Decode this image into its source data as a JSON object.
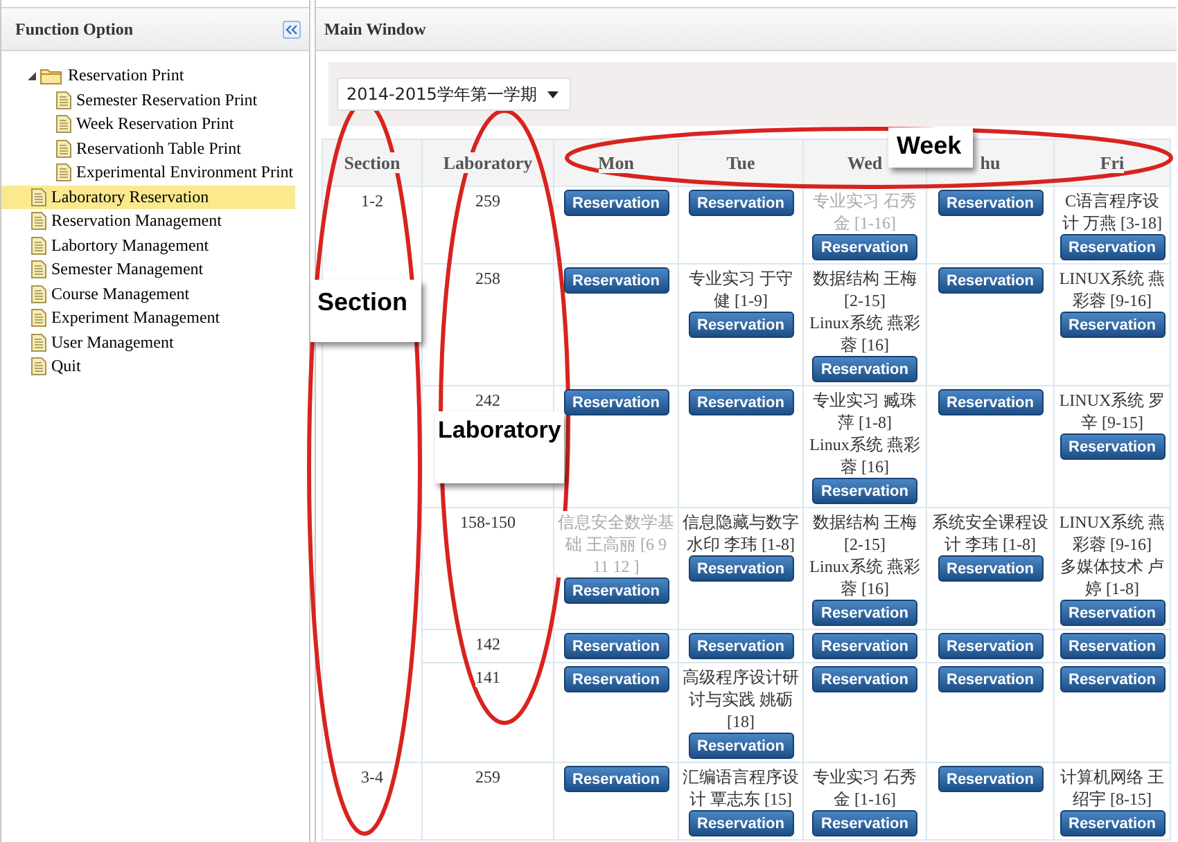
{
  "sidebar": {
    "title": "Function Option",
    "tree": [
      {
        "label": "Reservation Print",
        "kind": "folder",
        "expanded": true,
        "selected": false,
        "children": [
          {
            "label": "Semester Reservation Print",
            "kind": "page",
            "selected": false
          },
          {
            "label": "Week Reservation Print",
            "kind": "page",
            "selected": false
          },
          {
            "label": "Reservationh Table Print",
            "kind": "page",
            "selected": false
          },
          {
            "label": "Experimental Environment Print",
            "kind": "page",
            "selected": false
          }
        ]
      },
      {
        "label": "Laboratory Reservation",
        "kind": "page",
        "selected": true
      },
      {
        "label": "Reservation Management",
        "kind": "page",
        "selected": false
      },
      {
        "label": "Labortory Management",
        "kind": "page",
        "selected": false
      },
      {
        "label": "Semester Management",
        "kind": "page",
        "selected": false
      },
      {
        "label": "Course Management",
        "kind": "page",
        "selected": false
      },
      {
        "label": "Experiment Management",
        "kind": "page",
        "selected": false
      },
      {
        "label": "User Management",
        "kind": "page",
        "selected": false
      },
      {
        "label": "Quit",
        "kind": "page",
        "selected": false
      }
    ]
  },
  "main": {
    "title": "Main Window",
    "semester": "2014-2015学年第一学期",
    "table": {
      "columns": [
        "Section",
        "Laboratory",
        "Mon",
        "Tue",
        "Wed",
        "hu",
        "Fri"
      ],
      "sections": [
        {
          "label": "1-2",
          "rows": [
            {
              "lab": "259",
              "cells": [
                {
                  "button": "Reservation"
                },
                {
                  "button": "Reservation"
                },
                {
                  "courses": [
                    {
                      "text": "专业实习 石秀金 [1-16]",
                      "faded": true
                    }
                  ],
                  "button": "Reservation"
                },
                {
                  "button": "Reservation"
                },
                {
                  "courses": [
                    {
                      "text": "C语言程序设计 万燕 [3-18]",
                      "faded": false
                    }
                  ],
                  "button": "Reservation"
                }
              ]
            },
            {
              "lab": "258",
              "cells": [
                {
                  "button": "Reservation"
                },
                {
                  "courses": [
                    {
                      "text": "专业实习 于守健 [1-9]",
                      "faded": false
                    }
                  ],
                  "button": "Reservation"
                },
                {
                  "courses": [
                    {
                      "text": "数据结构 王梅 [2-15]",
                      "faded": false
                    },
                    {
                      "text": "Linux系统 燕彩蓉 [16]",
                      "faded": false
                    }
                  ],
                  "button": "Reservation"
                },
                {
                  "button": "Reservation"
                },
                {
                  "courses": [
                    {
                      "text": "LINUX系统 燕彩蓉 [9-16]",
                      "faded": false
                    }
                  ],
                  "button": "Reservation"
                }
              ]
            },
            {
              "lab": "242",
              "cells": [
                {
                  "button": "Reservation"
                },
                {
                  "button": "Reservation"
                },
                {
                  "courses": [
                    {
                      "text": "专业实习 臧珠萍 [1-8]",
                      "faded": false
                    },
                    {
                      "text": "Linux系统 燕彩蓉 [16]",
                      "faded": false
                    }
                  ],
                  "button": "Reservation"
                },
                {
                  "button": "Reservation"
                },
                {
                  "courses": [
                    {
                      "text": "LINUX系统 罗辛 [9-15]",
                      "faded": false
                    }
                  ],
                  "button": "Reservation"
                }
              ]
            },
            {
              "lab": "158-150",
              "cells": [
                {
                  "courses": [
                    {
                      "text": "信息安全数学基础 王高丽 [6 9 11 12 ]",
                      "faded": true
                    }
                  ],
                  "button": "Reservation"
                },
                {
                  "courses": [
                    {
                      "text": "信息隐藏与数字水印 李玮 [1-8]",
                      "faded": false
                    }
                  ],
                  "button": "Reservation"
                },
                {
                  "courses": [
                    {
                      "text": "数据结构 王梅 [2-15]",
                      "faded": false
                    },
                    {
                      "text": "Linux系统 燕彩蓉 [16]",
                      "faded": false
                    }
                  ],
                  "button": "Reservation"
                },
                {
                  "courses": [
                    {
                      "text": "系统安全课程设计 李玮 [1-8]",
                      "faded": false
                    }
                  ],
                  "button": "Reservation"
                },
                {
                  "courses": [
                    {
                      "text": "LINUX系统 燕彩蓉 [9-16]",
                      "faded": false
                    },
                    {
                      "text": "多媒体技术 卢婷 [1-8]",
                      "faded": false
                    }
                  ],
                  "button": "Reservation"
                }
              ]
            },
            {
              "lab": "142",
              "cells": [
                {
                  "button": "Reservation"
                },
                {
                  "button": "Reservation"
                },
                {
                  "button": "Reservation"
                },
                {
                  "button": "Reservation"
                },
                {
                  "button": "Reservation"
                }
              ]
            },
            {
              "lab": "141",
              "cells": [
                {
                  "button": "Reservation"
                },
                {
                  "courses": [
                    {
                      "text": "高级程序设计研讨与实践 姚砺 [18]",
                      "faded": false
                    }
                  ],
                  "button": "Reservation"
                },
                {
                  "button": "Reservation"
                },
                {
                  "button": "Reservation"
                },
                {
                  "button": "Reservation"
                }
              ]
            }
          ]
        },
        {
          "label": "3-4",
          "rows": [
            {
              "lab": "259",
              "cells": [
                {
                  "button": "Reservation"
                },
                {
                  "courses": [
                    {
                      "text": "汇编语言程序设计 覃志东 [15]",
                      "faded": false
                    }
                  ],
                  "button": "Reservation"
                },
                {
                  "courses": [
                    {
                      "text": "专业实习 石秀金 [1-16]",
                      "faded": false
                    }
                  ],
                  "button": "Reservation"
                },
                {
                  "button": "Reservation"
                },
                {
                  "courses": [
                    {
                      "text": "计算机网络 王绍宇 [8-15]",
                      "faded": false
                    }
                  ],
                  "button": "Reservation"
                }
              ]
            }
          ]
        }
      ]
    }
  },
  "annotations": [
    {
      "text": "Section"
    },
    {
      "text": "Laboratory"
    },
    {
      "text": "Week"
    }
  ]
}
